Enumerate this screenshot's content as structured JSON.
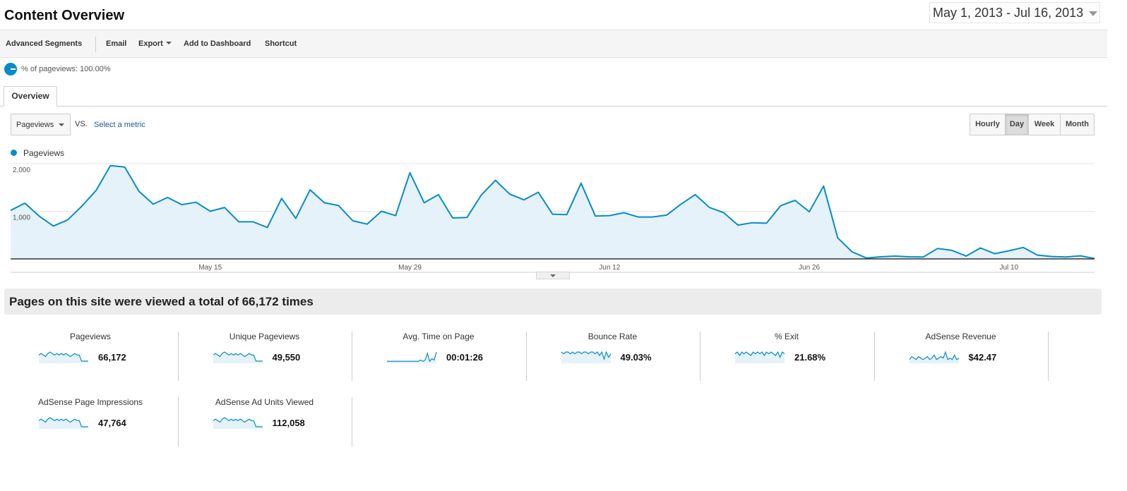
{
  "header": {
    "title": "Content Overview",
    "date_range": "May 1, 2013 - Jul 16, 2013"
  },
  "toolbar": {
    "advanced_segments": "Advanced Segments",
    "email": "Email",
    "export": "Export",
    "add_to_dashboard": "Add to Dashboard",
    "shortcut": "Shortcut"
  },
  "segment": {
    "label": "% of pageviews: 100.00%"
  },
  "tabs": {
    "overview": "Overview"
  },
  "chart_controls": {
    "metric": "Pageviews",
    "vs": "VS.",
    "select_metric": "Select a metric",
    "granularity": [
      "Hourly",
      "Day",
      "Week",
      "Month"
    ],
    "active_granularity": "Day"
  },
  "chart_data": {
    "type": "area",
    "series": [
      {
        "name": "Pageviews",
        "color": "#058dc7",
        "values": [
          1020,
          1170,
          900,
          690,
          820,
          1110,
          1440,
          1960,
          1930,
          1420,
          1150,
          1290,
          1140,
          1190,
          1000,
          1080,
          780,
          780,
          660,
          1270,
          850,
          1450,
          1180,
          1120,
          800,
          730,
          1000,
          910,
          1810,
          1180,
          1350,
          860,
          870,
          1340,
          1650,
          1360,
          1240,
          1400,
          940,
          930,
          1590,
          900,
          910,
          970,
          880,
          880,
          920,
          1150,
          1350,
          1080,
          970,
          710,
          760,
          750,
          1120,
          1230,
          990,
          1530,
          440,
          150,
          20,
          45,
          60,
          45,
          40,
          220,
          180,
          60,
          230,
          110,
          170,
          240,
          80,
          50,
          40,
          65,
          10
        ]
      }
    ],
    "x_tick_labels": [
      "May 15",
      "May 29",
      "Jun 12",
      "Jun 26",
      "Jul 10"
    ],
    "x_tick_day_index": [
      14,
      28,
      42,
      56,
      70
    ],
    "y_tick_labels": [
      "2,000",
      "1,000"
    ],
    "y_tick_values": [
      2000,
      1000
    ],
    "ylim": [
      0,
      2030
    ],
    "grid": true
  },
  "summary": {
    "text": "Pages on this site were viewed a total of 66,172 times"
  },
  "stats": [
    {
      "label": "Pageviews",
      "value": "66,172",
      "spark": [
        5,
        6,
        5,
        4,
        6,
        7,
        6,
        5,
        6,
        5,
        6,
        5,
        6,
        5,
        4,
        5,
        6,
        5,
        5,
        1,
        1,
        1,
        1
      ]
    },
    {
      "label": "Unique Pageviews",
      "value": "49,550",
      "spark": [
        5,
        6,
        5,
        4,
        6,
        7,
        6,
        5,
        6,
        5,
        6,
        5,
        6,
        5,
        4,
        5,
        6,
        5,
        5,
        1,
        1,
        1,
        1
      ]
    },
    {
      "label": "Avg. Time on Page",
      "value": "00:01:26",
      "spark": [
        1,
        1,
        1,
        1,
        1,
        1,
        1,
        1,
        1,
        1,
        1,
        1,
        1,
        1,
        1,
        2,
        1,
        2,
        7,
        1,
        3,
        2,
        8
      ]
    },
    {
      "label": "Bounce Rate",
      "value": "49.03%",
      "spark": [
        6,
        5,
        6,
        6,
        5,
        6,
        5,
        6,
        6,
        5,
        6,
        6,
        5,
        6,
        6,
        5,
        6,
        4,
        6,
        2,
        6,
        3,
        5
      ]
    },
    {
      "label": "% Exit",
      "value": "21.68%",
      "spark": [
        5,
        6,
        4,
        6,
        5,
        6,
        5,
        4,
        6,
        5,
        6,
        5,
        6,
        4,
        6,
        5,
        6,
        5,
        4,
        6,
        3,
        6,
        5
      ]
    },
    {
      "label": "AdSense Revenue",
      "value": "$42.47",
      "spark": [
        2,
        4,
        3,
        2,
        4,
        3,
        2,
        3,
        4,
        2,
        3,
        5,
        2,
        3,
        4,
        3,
        7,
        2,
        3,
        2,
        5,
        2,
        3
      ]
    },
    {
      "label": "AdSense Page Impressions",
      "value": "47,764",
      "spark": [
        5,
        6,
        5,
        4,
        6,
        7,
        6,
        5,
        6,
        5,
        6,
        5,
        6,
        5,
        4,
        5,
        6,
        5,
        5,
        1,
        1,
        1,
        1
      ]
    },
    {
      "label": "AdSense Ad Units Viewed",
      "value": "112,058",
      "spark": [
        5,
        6,
        5,
        4,
        6,
        7,
        6,
        5,
        6,
        5,
        6,
        5,
        6,
        5,
        4,
        5,
        6,
        5,
        5,
        1,
        1,
        1,
        1
      ]
    }
  ]
}
